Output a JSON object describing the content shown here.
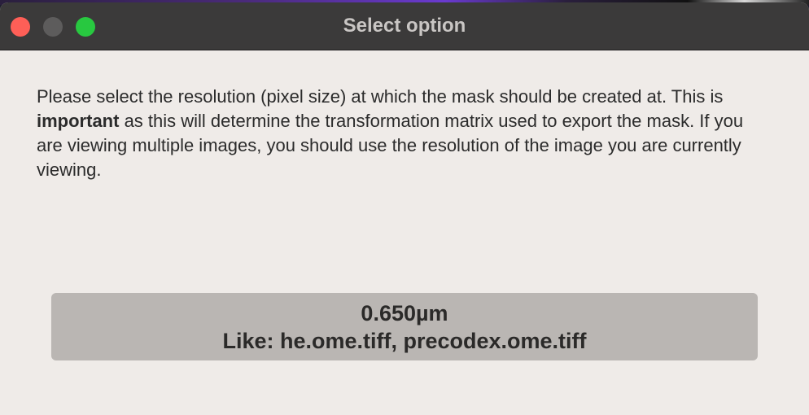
{
  "window": {
    "title": "Select option"
  },
  "message": {
    "part1": "Please select the resolution (pixel size) at which the mask should be created at. This is ",
    "bold": "important",
    "part2": " as this will determine the transformation matrix used to export the mask. If you are viewing multiple images, you should use the resolution of the image you are currently viewing."
  },
  "option": {
    "resolution": "0.650µm",
    "like": "Like: he.ome.tiff, precodex.ome.tiff"
  },
  "colors": {
    "close": "#fe5f57",
    "minimize": "#5d5c5c",
    "zoom": "#28c840",
    "titlebar": "#3b3a3a",
    "background": "#efebe8",
    "button": "#bab6b3"
  },
  "icons": {
    "close": "close-icon",
    "minimize": "minimize-icon",
    "zoom": "zoom-icon"
  }
}
